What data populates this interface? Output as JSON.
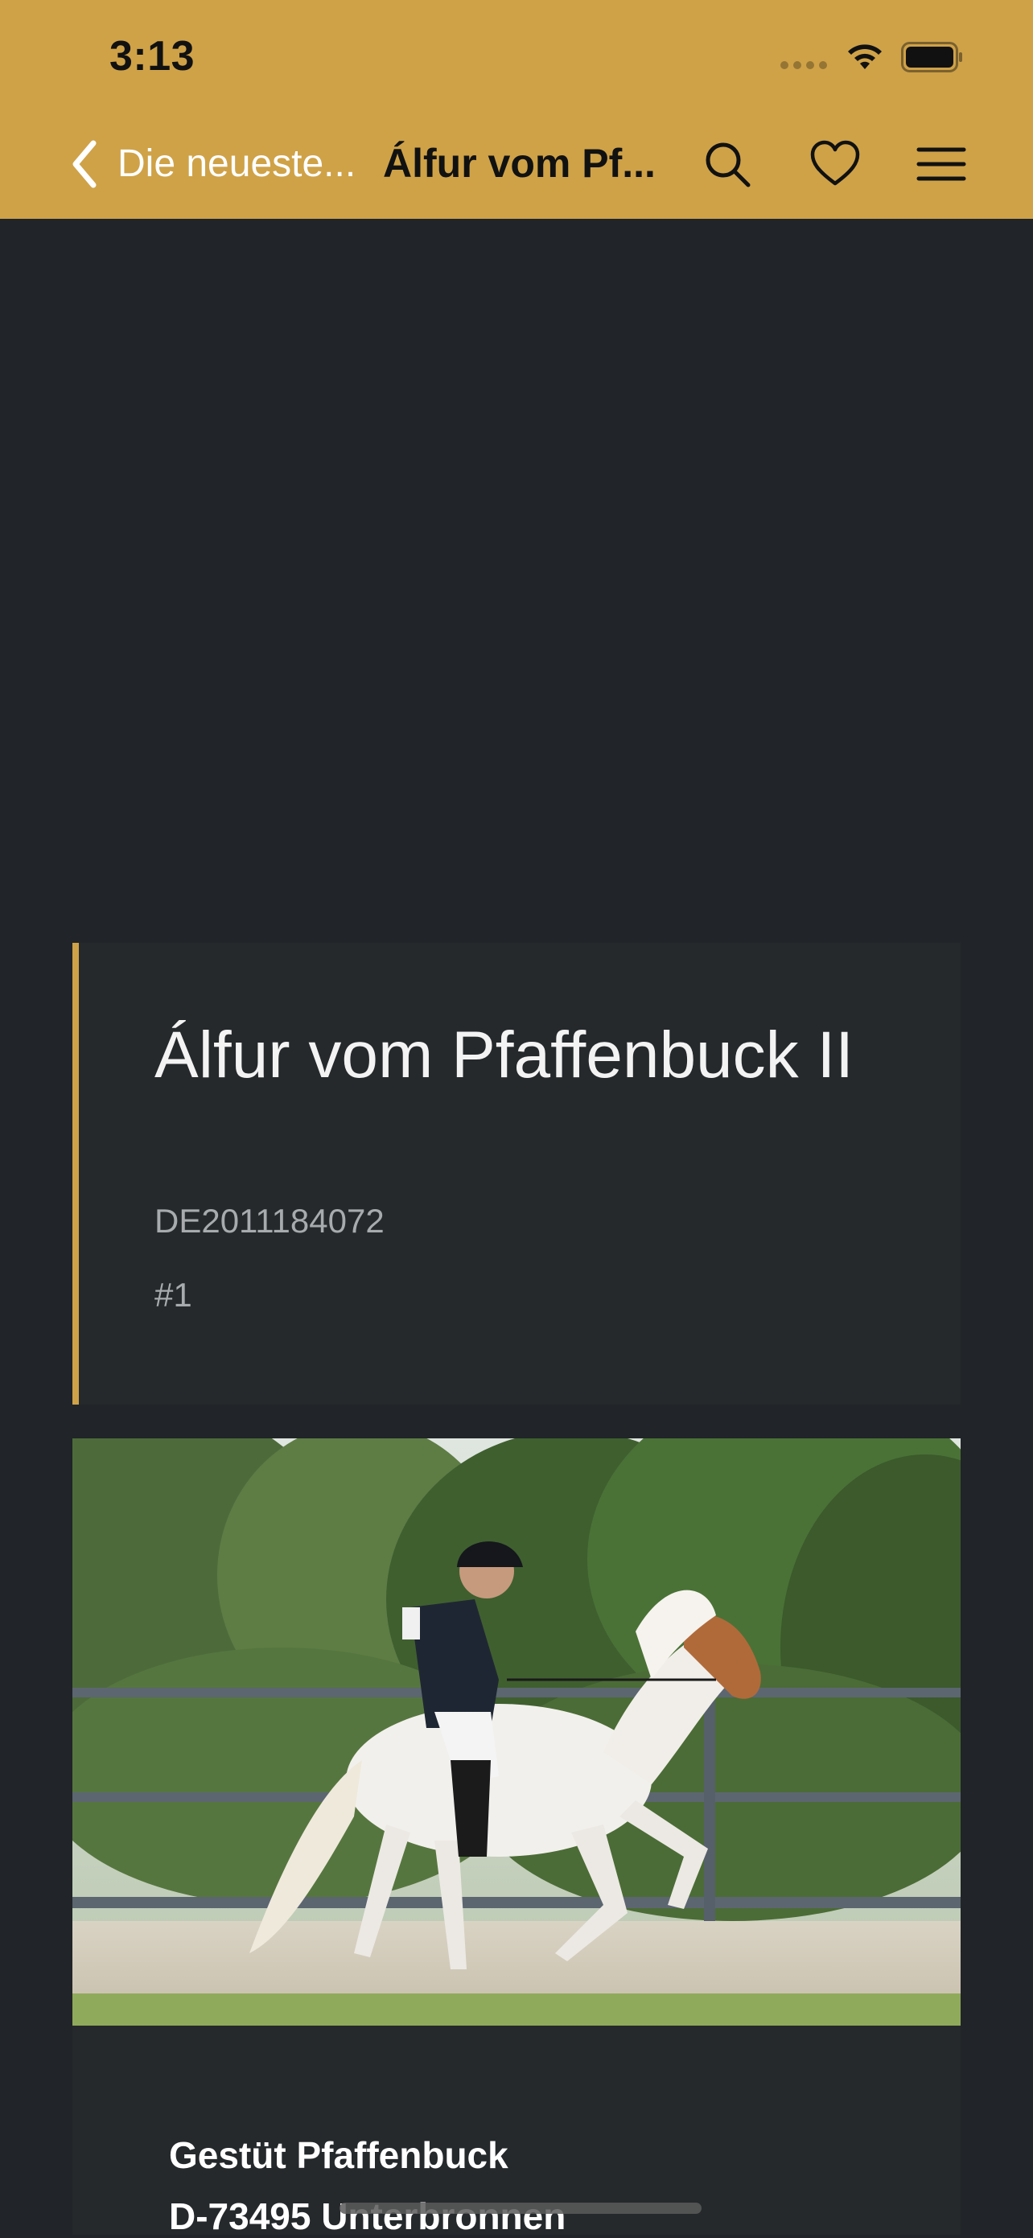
{
  "status_bar": {
    "time": "3:13"
  },
  "nav": {
    "back_label": "Die neueste...",
    "title": "Álfur vom Pf...",
    "icons": [
      "search-icon",
      "heart-icon",
      "menu-icon"
    ]
  },
  "horse": {
    "name": "Álfur vom Pfaffenbuck II",
    "registration": "DE2011184072",
    "rank": "#1"
  },
  "photo": {
    "icon": "horse-rider-photo"
  },
  "stud": {
    "name": "Gestüt Pfaffenbuck",
    "address": "D-73495 Unterbronnen"
  },
  "colors": {
    "accent": "#cfa248",
    "background": "#212428",
    "card": "#25292c"
  }
}
